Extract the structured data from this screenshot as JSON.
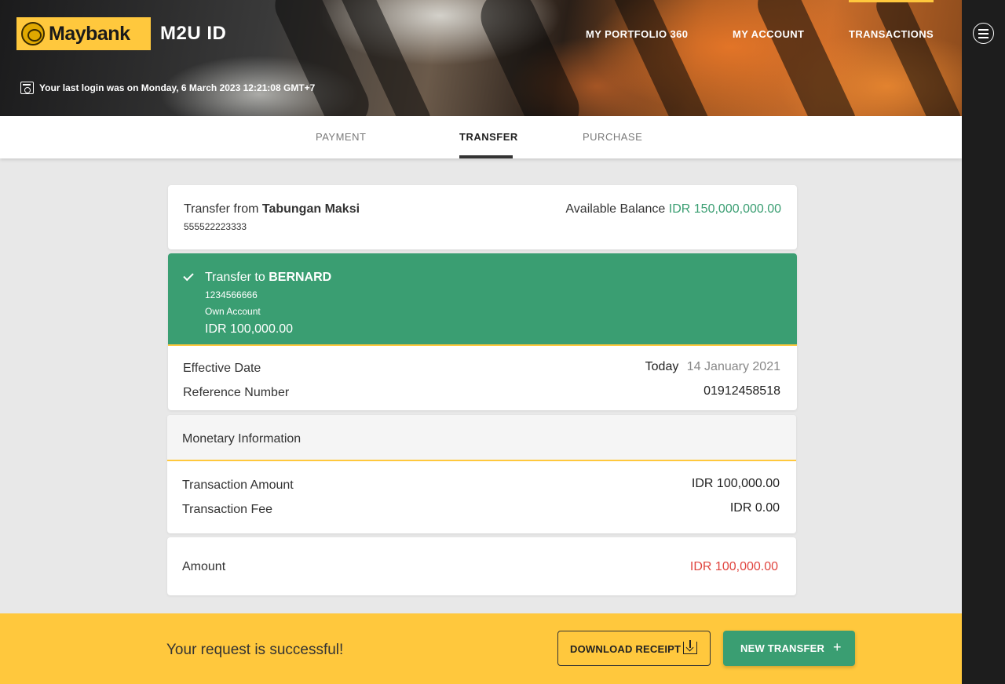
{
  "header": {
    "logo_text": "Maybank",
    "app_title": "M2U ID",
    "nav": [
      "MY PORTFOLIO 360",
      "MY ACCOUNT",
      "TRANSACTIONS"
    ],
    "last_login": "Your last login was on Monday, 6 March 2023 12:21:08 GMT+7",
    "icons": [
      "tiger-logo-icon",
      "calendar-clock-icon",
      "menu-icon"
    ]
  },
  "tabs": [
    "PAYMENT",
    "TRANSFER",
    "PURCHASE"
  ],
  "active_tab": "TRANSFER",
  "from": {
    "label": "Transfer from",
    "account_name": "Tabungan Maksi",
    "account_number": "555522223333",
    "balance_label": "Available Balance",
    "balance_value": "IDR 150,000,000.00"
  },
  "to": {
    "label": "Transfer to",
    "name": "BERNARD",
    "account_number": "1234566666",
    "account_type": "Own Account",
    "amount": "IDR 100,000.00"
  },
  "details": {
    "effective_date_label": "Effective Date",
    "today_label": "Today",
    "effective_date_value": "14 January 2021",
    "reference_label": "Reference Number",
    "reference_value": "01912458518"
  },
  "monetary": {
    "title": "Monetary Information",
    "transaction_amount_label": "Transaction Amount",
    "transaction_amount_value": "IDR 100,000.00",
    "transaction_fee_label": "Transaction Fee",
    "transaction_fee_value": "IDR 0.00"
  },
  "total": {
    "label": "Amount",
    "value": "IDR 100,000.00"
  },
  "footer": {
    "message": "Your request is successful!",
    "download_label": "DOWNLOAD RECEIPT",
    "new_transfer_label": "NEW TRANSFER"
  },
  "colors": {
    "brand_yellow": "#ffc83d",
    "success_green": "#3a9e72",
    "amount_red": "#e0453f"
  }
}
